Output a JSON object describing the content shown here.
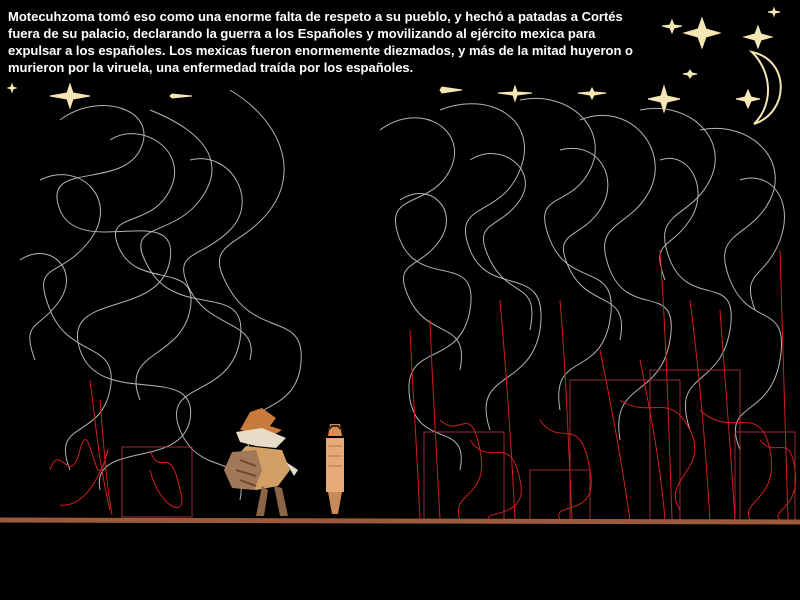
{
  "narration": {
    "lines": [
      "Motecuhzoma tomó eso como una enorme falta de respeto a su pueblo, y hechó a patadas a Cortés",
      "fuera de su palacio, declarando la guerra a los Españoles y movilizando al ejército mexica para",
      "expulsar a los españoles. Los mexicas fueron enormemente diezmados, y más de la mitad huyeron o",
      "murieron por la viruela, una enfermedad traída por los españoles."
    ]
  },
  "scene": {
    "background_color": "#000000",
    "ground_color": "#9b5a3c",
    "smoke_color": "#c8c8c8",
    "fire_color": "#d21e1e",
    "star_color": "#f5e6b4",
    "moon_color": "#f5e6b4",
    "characters": [
      "cortes-sprite",
      "motecuhzoma-sprite"
    ]
  }
}
